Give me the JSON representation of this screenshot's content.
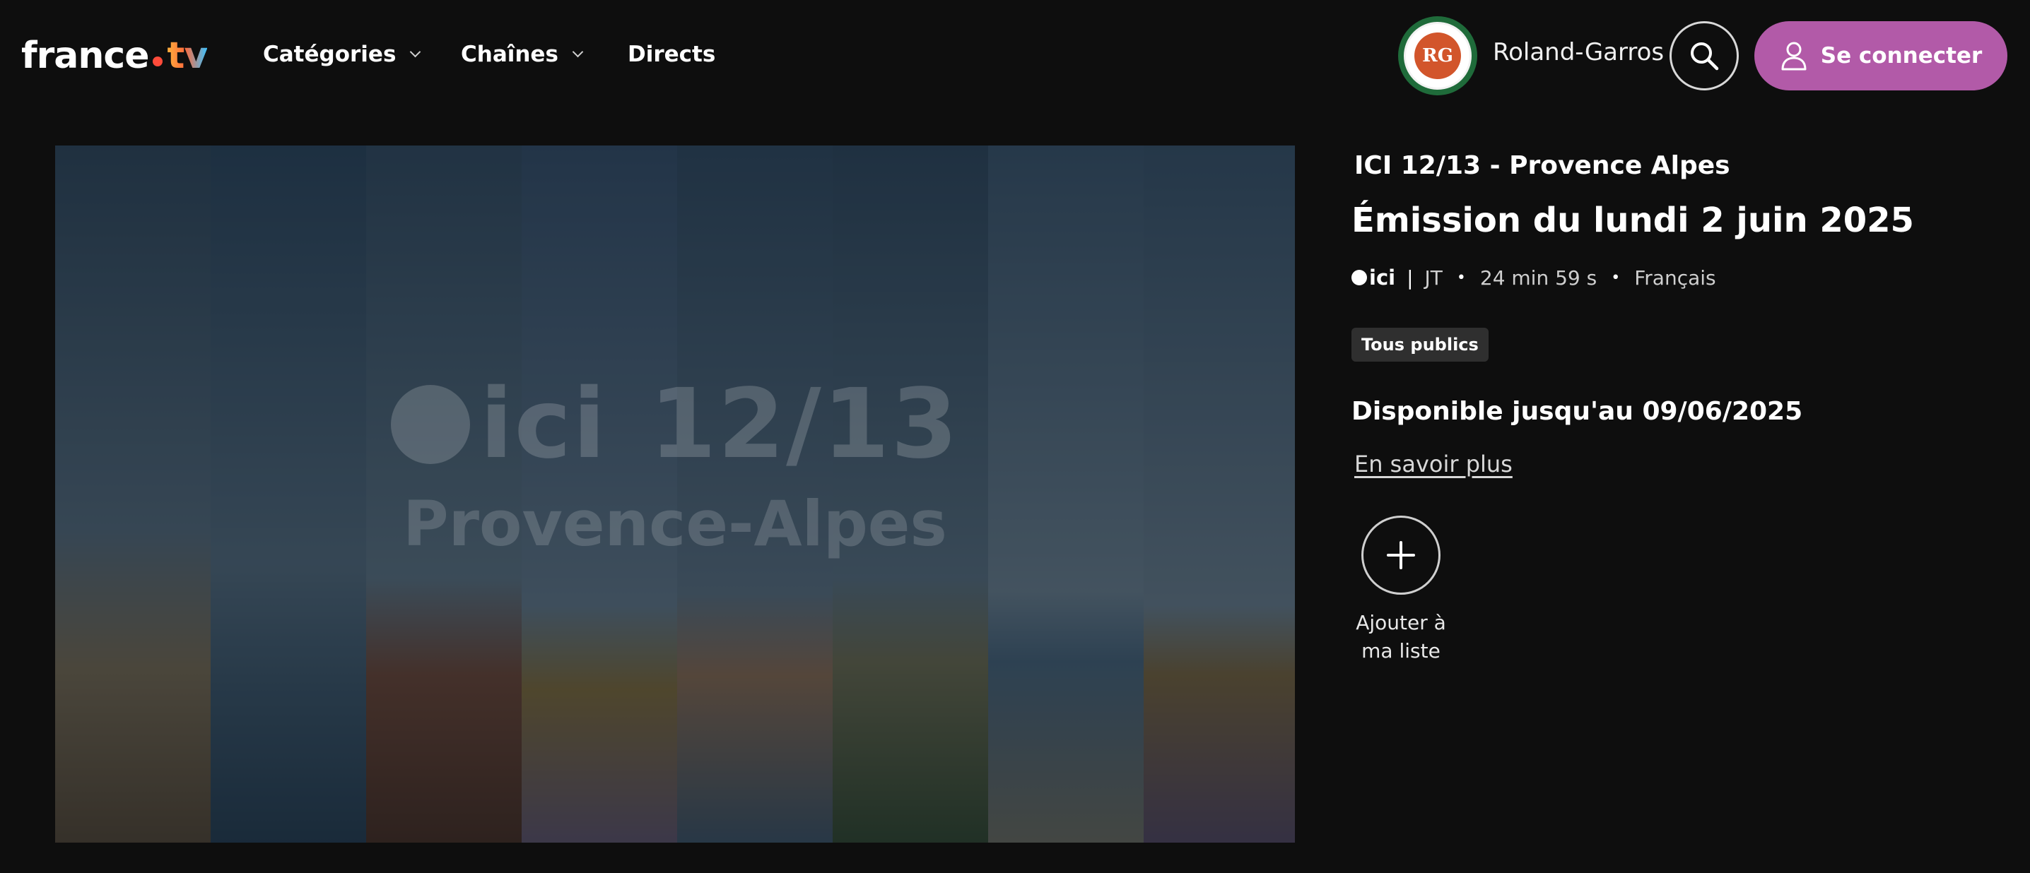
{
  "header": {
    "logo_main": "france",
    "logo_suffix": "tv",
    "nav": [
      {
        "label": "Catégories",
        "has_dropdown": true
      },
      {
        "label": "Chaînes",
        "has_dropdown": true
      },
      {
        "label": "Directs",
        "has_dropdown": false
      }
    ],
    "event_badge_alt": "Roland Garros Paris",
    "event_badge_monogram": "RG",
    "event_label": "Roland-Garros",
    "search_icon": "search-icon",
    "login_label": "Se connecter",
    "login_icon": "user-icon",
    "accent_color": "#b25aa8"
  },
  "hero": {
    "overlay_title": "12/13",
    "overlay_title_prefix": "ici",
    "overlay_subtitle": "Provence-Alpes"
  },
  "program": {
    "show_name": "ICI 12/13 - Provence Alpes",
    "episode_title": "Émission du lundi 2 juin 2025",
    "channel_logo": "ici",
    "genre": "JT",
    "duration": "24 min 59 s",
    "language": "Français",
    "rating": "Tous publics",
    "availability": "Disponible jusqu'au 09/06/2025",
    "learn_more": "En savoir plus",
    "add_to_list_label": "Ajouter à ma liste",
    "add_icon": "plus-icon"
  }
}
